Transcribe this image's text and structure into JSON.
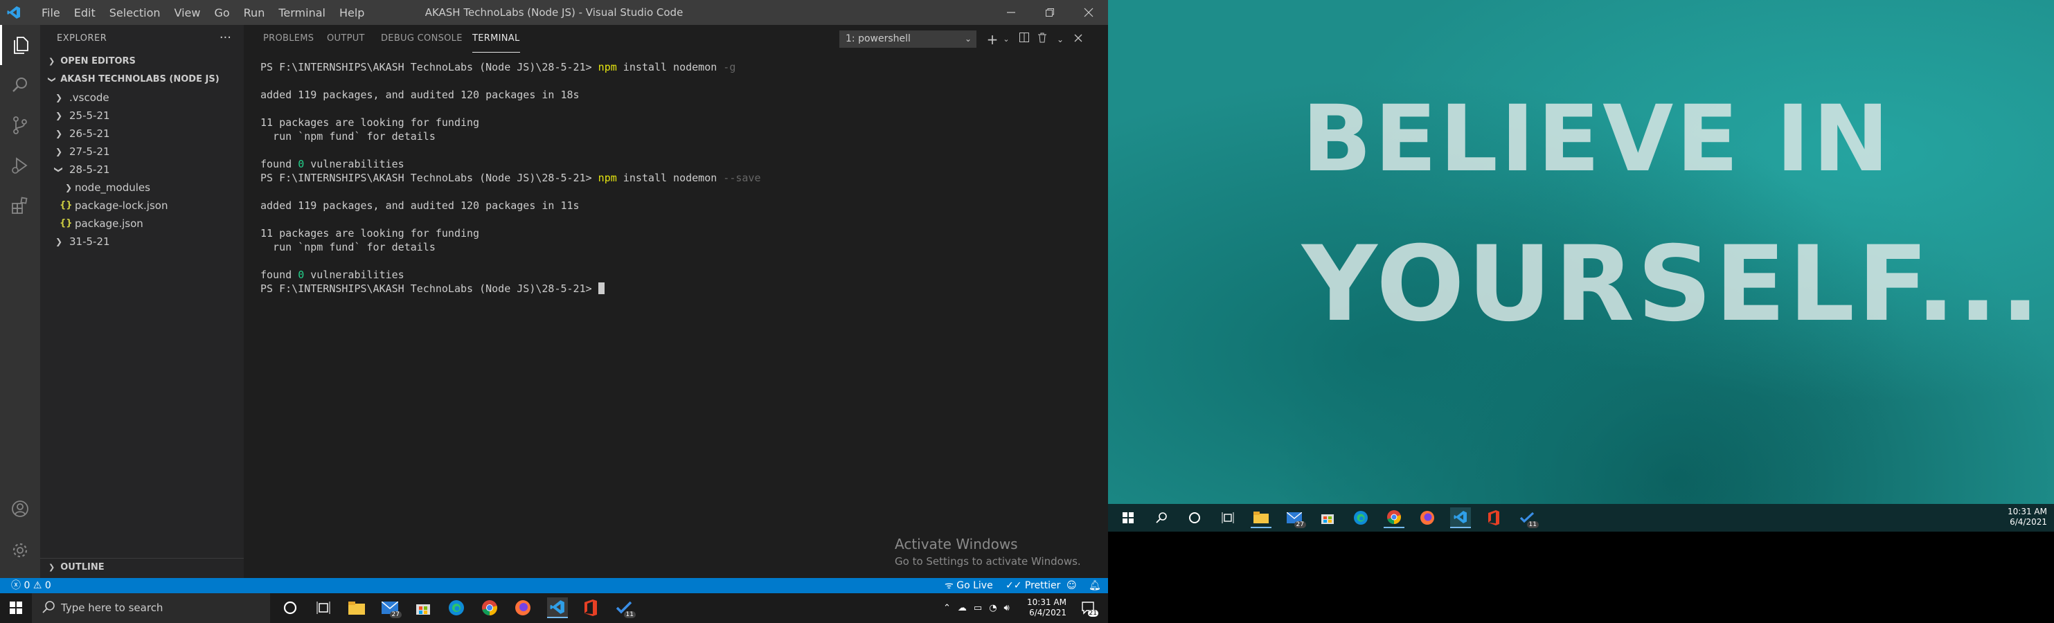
{
  "vscode": {
    "window_title": "AKASH TechnoLabs (Node JS) - Visual Studio Code",
    "menu": [
      "File",
      "Edit",
      "Selection",
      "View",
      "Go",
      "Run",
      "Terminal",
      "Help"
    ],
    "accent": "#007acc"
  },
  "sidebar": {
    "title": "EXPLORER",
    "open_editors": "OPEN EDITORS",
    "project": "AKASH TECHNOLABS (NODE JS)",
    "items": [
      {
        "label": ".vscode",
        "type": "folder",
        "expanded": false
      },
      {
        "label": "25-5-21",
        "type": "folder",
        "expanded": false
      },
      {
        "label": "26-5-21",
        "type": "folder",
        "expanded": false
      },
      {
        "label": "27-5-21",
        "type": "folder",
        "expanded": false
      },
      {
        "label": "28-5-21",
        "type": "folder",
        "expanded": true
      },
      {
        "label": "node_modules",
        "type": "folder",
        "expanded": false
      },
      {
        "label": "package-lock.json",
        "type": "json-file"
      },
      {
        "label": "package.json",
        "type": "json-file"
      },
      {
        "label": "31-5-21",
        "type": "folder",
        "expanded": false
      }
    ],
    "outline": "OUTLINE"
  },
  "panel": {
    "tabs": [
      "PROBLEMS",
      "OUTPUT",
      "DEBUG CONSOLE",
      "TERMINAL"
    ],
    "active_tab": "TERMINAL",
    "terminal_select": "1: powershell"
  },
  "terminal": {
    "prompt1": "PS F:\\INTERNSHIPS\\AKASH TechnoLabs (Node JS)\\28-5-21>",
    "cmd_npm": "npm",
    "cmd1_rest": "install nodemon",
    "cmd1_flag": "-g",
    "added1": "added 119 packages, and audited 120 packages in 18s",
    "funding1": "11 packages are looking for funding",
    "fund_hint1": "  run `npm fund` for details",
    "found_pre1": "found",
    "found_num1": "0",
    "found_post1": "vulnerabilities",
    "prompt2": "PS F:\\INTERNSHIPS\\AKASH TechnoLabs (Node JS)\\28-5-21>",
    "cmd2_rest": "install nodemon",
    "cmd2_flag": "--save",
    "added2": "added 119 packages, and audited 120 packages in 11s",
    "funding2": "11 packages are looking for funding",
    "fund_hint2": "  run `npm fund` for details",
    "found_pre2": "found",
    "found_num2": "0",
    "found_post2": "vulnerabilities",
    "prompt3": "PS F:\\INTERNSHIPS\\AKASH TechnoLabs (Node JS)\\28-5-21>"
  },
  "watermark": {
    "line1": "Activate Windows",
    "line2": "Go to Settings to activate Windows."
  },
  "statusbar": {
    "errors": "0",
    "warnings": "0",
    "go_live": "Go Live",
    "prettier": "Prettier"
  },
  "taskbar_left": {
    "search_placeholder": "Type here to search",
    "mail_badge": "27",
    "todo_badge": "11",
    "time": "10:31 AM",
    "date": "6/4/2021",
    "notif_count": "21"
  },
  "wallpaper": {
    "line1": "BELIEVE IN",
    "line2": "YOURSELF..."
  },
  "taskbar_right": {
    "mail_badge": "27",
    "todo_badge": "11",
    "time": "10:31 AM",
    "date": "6/4/2021"
  }
}
